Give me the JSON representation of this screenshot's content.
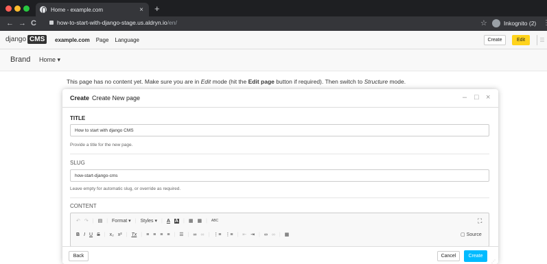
{
  "browser": {
    "tab_title": "Home - example.com",
    "tab_close": "×",
    "new_tab": "+",
    "url_host": "how-to-start-with-django-stage.us.aldryn.io",
    "url_path": "/en/",
    "profile_label": "Inkognito (2)",
    "back": "←",
    "forward": "→",
    "reload": "C",
    "star": "☆",
    "menu": "⋮",
    "traffic_colors": [
      "#ff5f57",
      "#febc2e",
      "#28c840"
    ]
  },
  "cms_toolbar": {
    "logo_text": "django",
    "logo_badge": "CMS",
    "site_name": "example.com",
    "menu_items": [
      "Page",
      "Language"
    ],
    "create_label": "Create",
    "edit_label": "Edit",
    "sidebar_glyph": "☰"
  },
  "navbar": {
    "brand": "Brand",
    "home_label": "Home ▾"
  },
  "page_message": {
    "part1": "This page has no content yet. Make sure you are in ",
    "edit": "Edit",
    "part2": " mode (hit the ",
    "edit_page": "Edit page",
    "part3": " button if required). Then switch to ",
    "structure": "Structure",
    "part4": " mode."
  },
  "modal": {
    "title_bold": "Create",
    "title_rest": "Create New page",
    "minimize": "–",
    "maximize": "□",
    "close": "×",
    "title_label": "TITLE",
    "title_value": "How to start with django CMS",
    "title_help": "Provide a title for the new page.",
    "slug_label": "SLUG",
    "slug_value": "how-start-django-cms",
    "slug_help": "Leave empty for automatic slug, or override as required.",
    "content_label": "CONTENT",
    "editor_row1": {
      "undo": "↶",
      "redo": "↷",
      "paste": "▤",
      "format": "Format",
      "styles": "Styles",
      "text_color": "A",
      "bg_color": "A",
      "paste_text": "▦",
      "paste_word": "▦",
      "spell": "ABC",
      "maximize": "⛶"
    },
    "editor_row2": {
      "bold": "B",
      "italic": "I",
      "underline": "U",
      "strike": "S",
      "subscript": "x₂",
      "superscript": "x²",
      "clear": "Tx",
      "align_left": "≡",
      "align_center": "≡",
      "align_right": "≡",
      "justify": "≡",
      "hr": "☰",
      "link": "∞",
      "unlink": "∞",
      "ol": "⋮≡",
      "ul": "⋮≡",
      "outdent": "⇤",
      "indent": "⇥",
      "anchor": "∞",
      "unanchor": "∞",
      "table": "▦",
      "source_label": "Source"
    },
    "back_label": "Back",
    "cancel_label": "Cancel",
    "create_label": "Create"
  }
}
